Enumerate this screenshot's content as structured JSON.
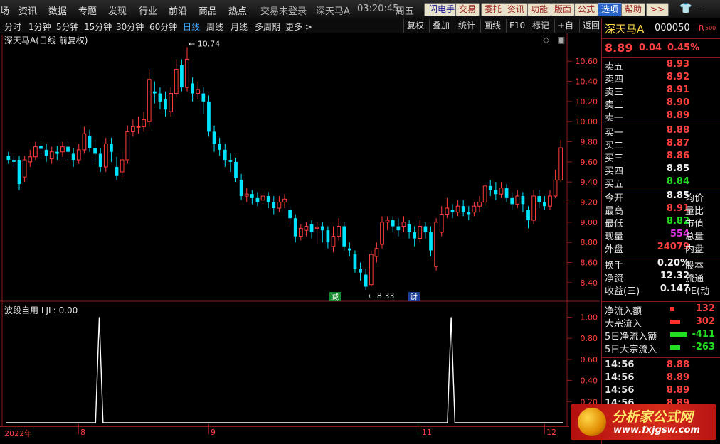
{
  "menu": {
    "items": [
      "场",
      "资讯",
      "数据",
      "专题",
      "发现",
      "行业",
      "前沿",
      "商品",
      "热点"
    ],
    "login": "交易未登录",
    "stock": "深天马A",
    "time": "03:20:45",
    "weekday": "周五",
    "buttons": [
      "闪电手",
      "交易",
      "委托",
      "资讯",
      "功能",
      "版面",
      "公式",
      "选项",
      "帮助",
      ">>"
    ]
  },
  "toolbar": {
    "periods": [
      "分时",
      "1分钟",
      "5分钟",
      "15分钟",
      "30分钟",
      "60分钟",
      "日线",
      "周线",
      "月线",
      "多周期",
      "更多 >"
    ],
    "active": "日线",
    "tools": [
      "复权",
      "叠加",
      "统计",
      "画线",
      "F10",
      "标记",
      "+自选",
      "返回"
    ]
  },
  "main_title": "深天马A(日线 前复权)",
  "sub_title": "波段自用  LJL: 0.00",
  "annotations": {
    "high": "10.74",
    "low": "8.33",
    "tag1": "减",
    "tag2": "财"
  },
  "x_axis_labels": [
    "2022年",
    "8",
    "9",
    "11",
    "12"
  ],
  "chart_data": [
    {
      "type": "candlestick",
      "title": "深天马A(日线 前复权)",
      "ylim": [
        8.3,
        10.75
      ],
      "yticks": [
        8.4,
        8.6,
        8.8,
        9.0,
        9.2,
        9.4,
        9.6,
        9.8,
        10.0,
        10.2,
        10.4,
        10.6
      ],
      "colors": {
        "up": "#ff3c3c",
        "down": "#00e5ff"
      },
      "candles": [
        [
          9.66,
          9.62,
          9.7,
          9.58
        ],
        [
          9.62,
          9.6,
          9.66,
          9.55
        ],
        [
          9.62,
          9.38,
          9.66,
          9.32
        ],
        [
          9.45,
          9.62,
          9.66,
          9.4
        ],
        [
          9.6,
          9.65,
          9.72,
          9.55
        ],
        [
          9.65,
          9.75,
          9.8,
          9.62
        ],
        [
          9.76,
          9.73,
          9.8,
          9.68
        ],
        [
          9.72,
          9.66,
          9.78,
          9.6
        ],
        [
          9.63,
          9.7,
          9.75,
          9.58
        ],
        [
          9.7,
          9.68,
          9.76,
          9.62
        ],
        [
          9.7,
          9.75,
          9.8,
          9.65
        ],
        [
          9.75,
          9.7,
          9.8,
          9.62
        ],
        [
          9.68,
          9.62,
          9.74,
          9.55
        ],
        [
          9.62,
          9.72,
          9.78,
          9.58
        ],
        [
          9.72,
          9.88,
          9.95,
          9.68
        ],
        [
          9.86,
          9.74,
          9.92,
          9.7
        ],
        [
          9.74,
          9.68,
          9.82,
          9.6
        ],
        [
          9.68,
          9.55,
          9.74,
          9.5
        ],
        [
          9.55,
          9.78,
          9.84,
          9.5
        ],
        [
          9.78,
          9.7,
          9.84,
          9.6
        ],
        [
          9.55,
          9.46,
          9.65,
          9.42
        ],
        [
          9.5,
          9.62,
          9.7,
          9.45
        ],
        [
          9.62,
          9.9,
          9.96,
          9.58
        ],
        [
          9.9,
          9.95,
          10.02,
          9.85
        ],
        [
          9.95,
          9.95,
          10.05,
          9.88
        ],
        [
          9.95,
          10.02,
          10.1,
          9.9
        ],
        [
          10.0,
          10.42,
          10.52,
          9.95
        ],
        [
          10.3,
          10.28,
          10.4,
          10.18
        ],
        [
          10.28,
          10.2,
          10.34,
          10.12
        ],
        [
          10.22,
          10.12,
          10.3,
          10.05
        ],
        [
          10.1,
          10.28,
          10.34,
          10.05
        ],
        [
          10.28,
          10.52,
          10.62,
          10.24
        ],
        [
          10.56,
          10.34,
          10.62,
          10.3
        ],
        [
          10.34,
          10.62,
          10.74,
          10.3
        ],
        [
          10.38,
          10.28,
          10.44,
          10.2
        ],
        [
          10.28,
          10.32,
          10.4,
          10.22
        ],
        [
          10.28,
          10.2,
          10.34,
          10.08
        ],
        [
          10.2,
          9.9,
          10.26,
          9.85
        ],
        [
          9.9,
          9.78,
          9.96,
          9.7
        ],
        [
          9.78,
          9.72,
          9.84,
          9.66
        ],
        [
          9.72,
          9.62,
          9.78,
          9.55
        ],
        [
          9.62,
          9.6,
          9.68,
          9.5
        ],
        [
          9.6,
          9.44,
          9.64,
          9.4
        ],
        [
          9.42,
          9.26,
          9.48,
          9.22
        ],
        [
          9.26,
          9.28,
          9.34,
          9.2
        ],
        [
          9.28,
          9.24,
          9.32,
          9.18
        ],
        [
          9.24,
          9.2,
          9.3,
          9.16
        ],
        [
          9.22,
          9.26,
          9.3,
          9.18
        ],
        [
          9.26,
          9.2,
          9.3,
          9.14
        ],
        [
          9.2,
          9.14,
          9.26,
          9.08
        ],
        [
          9.14,
          9.2,
          9.26,
          9.1
        ],
        [
          9.2,
          9.23,
          9.28,
          9.14
        ],
        [
          9.12,
          9.04,
          9.16,
          8.98
        ],
        [
          9.04,
          8.86,
          9.08,
          8.8
        ],
        [
          8.86,
          8.94,
          8.98,
          8.82
        ],
        [
          8.92,
          8.96,
          9.0,
          8.86
        ],
        [
          8.98,
          8.9,
          9.02,
          8.84
        ],
        [
          8.94,
          8.95,
          9.0,
          8.78
        ],
        [
          8.96,
          8.92,
          9.0,
          8.8
        ],
        [
          8.92,
          8.8,
          8.96,
          8.74
        ],
        [
          8.76,
          8.86,
          8.96,
          8.7
        ],
        [
          8.86,
          8.96,
          9.04,
          8.82
        ],
        [
          8.96,
          8.76,
          9.0,
          8.72
        ],
        [
          8.74,
          8.72,
          8.8,
          8.66
        ],
        [
          8.68,
          8.54,
          8.72,
          8.5
        ],
        [
          8.54,
          8.5,
          8.6,
          8.42
        ],
        [
          8.48,
          8.36,
          8.54,
          8.33
        ],
        [
          8.38,
          8.68,
          8.72,
          8.36
        ],
        [
          8.66,
          8.74,
          8.8,
          8.6
        ],
        [
          8.78,
          9.0,
          9.06,
          8.74
        ],
        [
          9.0,
          9.02,
          9.06,
          8.92
        ],
        [
          9.02,
          8.96,
          9.06,
          8.9
        ],
        [
          8.96,
          8.92,
          9.04,
          8.86
        ],
        [
          8.96,
          9.0,
          9.06,
          8.9
        ],
        [
          8.98,
          8.9,
          9.02,
          8.84
        ],
        [
          8.9,
          8.84,
          8.96,
          8.76
        ],
        [
          8.84,
          8.96,
          9.02,
          8.8
        ],
        [
          8.96,
          8.9,
          9.0,
          8.84
        ],
        [
          8.9,
          8.72,
          8.96,
          8.66
        ],
        [
          8.56,
          9.0,
          9.04,
          8.52
        ],
        [
          8.9,
          9.08,
          9.16,
          8.86
        ],
        [
          9.08,
          9.14,
          9.24,
          9.04
        ],
        [
          9.12,
          9.1,
          9.18,
          9.04
        ],
        [
          9.1,
          9.16,
          9.22,
          9.06
        ],
        [
          9.16,
          9.1,
          9.22,
          9.06
        ],
        [
          9.1,
          9.08,
          9.16,
          9.02
        ],
        [
          9.1,
          9.16,
          9.2,
          9.06
        ],
        [
          9.16,
          9.2,
          9.26,
          9.1
        ],
        [
          9.2,
          9.36,
          9.4,
          9.16
        ],
        [
          9.36,
          9.32,
          9.42,
          9.26
        ],
        [
          9.32,
          9.28,
          9.4,
          9.22
        ],
        [
          9.28,
          9.34,
          9.4,
          9.24
        ],
        [
          9.34,
          9.24,
          9.38,
          9.2
        ],
        [
          9.24,
          9.18,
          9.3,
          9.12
        ],
        [
          9.18,
          9.26,
          9.32,
          9.14
        ],
        [
          9.26,
          9.18,
          9.3,
          9.1
        ],
        [
          9.12,
          9.02,
          9.16,
          8.94
        ],
        [
          9.02,
          9.26,
          9.32,
          8.98
        ],
        [
          9.26,
          9.2,
          9.32,
          9.14
        ],
        [
          9.2,
          9.16,
          9.26,
          9.12
        ],
        [
          9.16,
          9.26,
          9.32,
          9.12
        ],
        [
          9.26,
          9.42,
          9.52,
          9.24
        ],
        [
          9.42,
          9.74,
          9.82,
          9.4
        ]
      ]
    },
    {
      "type": "line",
      "title": "波段自用",
      "series": [
        {
          "name": "LJL",
          "color": "#ffffff"
        }
      ],
      "ylim": [
        0,
        1.05
      ],
      "yticks": [
        0.2,
        0.4,
        0.6,
        0.8,
        1.0
      ],
      "values": [
        0,
        0,
        0,
        0,
        0,
        0,
        0,
        0,
        0,
        0,
        0,
        0,
        0,
        0,
        0,
        0,
        0,
        0,
        0,
        0,
        0,
        0,
        0,
        0,
        0,
        1,
        0,
        0,
        0,
        0,
        0,
        0,
        0,
        0,
        0,
        0,
        0,
        0,
        0,
        0,
        0,
        0,
        0,
        0,
        0,
        0,
        0,
        0,
        0,
        0,
        0,
        0,
        0,
        0,
        0,
        0,
        0,
        0,
        0,
        0,
        0,
        0,
        0,
        0,
        0,
        0,
        0,
        0,
        0,
        0,
        0,
        0,
        0,
        0,
        0,
        0,
        0,
        0,
        0,
        0,
        0,
        0,
        0,
        0,
        0,
        0,
        0,
        0,
        0,
        0,
        0,
        0,
        0,
        0,
        0,
        0,
        0,
        0,
        0,
        0,
        0,
        0,
        0,
        0,
        0,
        0,
        0,
        0,
        0,
        0,
        0,
        0,
        0,
        0,
        0,
        0,
        0,
        0,
        0,
        1,
        0,
        0,
        0,
        0,
        0,
        0,
        0,
        0,
        0,
        0,
        0,
        0,
        0,
        0,
        0,
        0,
        0,
        0,
        0,
        0,
        0,
        0,
        0,
        0,
        0,
        0,
        0,
        0,
        0,
        0
      ],
      "value_label": "LJL: 0.00"
    }
  ],
  "panel": {
    "name": "深天马A",
    "code": "000050",
    "badge": "R",
    "badge_num": "500",
    "price": "8.89",
    "change": "0.04",
    "pct": "0.45%",
    "asks": [
      {
        "label": "卖五",
        "price": "8.93"
      },
      {
        "label": "卖四",
        "price": "8.92"
      },
      {
        "label": "卖三",
        "price": "8.91"
      },
      {
        "label": "卖二",
        "price": "8.90"
      },
      {
        "label": "卖一",
        "price": "8.89"
      }
    ],
    "bids": [
      {
        "label": "买一",
        "price": "8.88"
      },
      {
        "label": "买二",
        "price": "8.87"
      },
      {
        "label": "买三",
        "price": "8.86"
      },
      {
        "label": "买四",
        "price": "8.85"
      },
      {
        "label": "买五",
        "price": "8.84"
      }
    ],
    "stats": [
      {
        "label": "今开",
        "value": "8.85",
        "label2": "均价"
      },
      {
        "label": "最高",
        "value": "8.91",
        "label2": "量比"
      },
      {
        "label": "最低",
        "value": "8.82",
        "label2": "市值"
      },
      {
        "label": "现量",
        "value": "554",
        "label2": "总量"
      },
      {
        "label": "外盘",
        "value": "24079",
        "label2": "内盘"
      }
    ],
    "stats2": [
      {
        "label": "换手",
        "value": "0.20%",
        "label2": "股本"
      },
      {
        "label": "净资",
        "value": "12.32",
        "label2": "流通"
      },
      {
        "label": "收益(三)",
        "value": "0.147",
        "label2": "PE(动"
      }
    ],
    "flows": [
      {
        "label": "净流入额",
        "value": "132"
      },
      {
        "label": "大宗流入",
        "value": "302"
      },
      {
        "label": "5日净流入额",
        "value": "-411"
      },
      {
        "label": "5日大宗流入",
        "value": "-263"
      }
    ],
    "ticks": [
      {
        "time": "14:56",
        "price": "8.88"
      },
      {
        "time": "14:56",
        "price": "8.89"
      },
      {
        "time": "14:56",
        "price": "8.89"
      },
      {
        "time": "14:56",
        "price": "8.89"
      }
    ]
  },
  "logo": {
    "title": "分析家公式网",
    "url": "www.fxjgsw.com"
  }
}
